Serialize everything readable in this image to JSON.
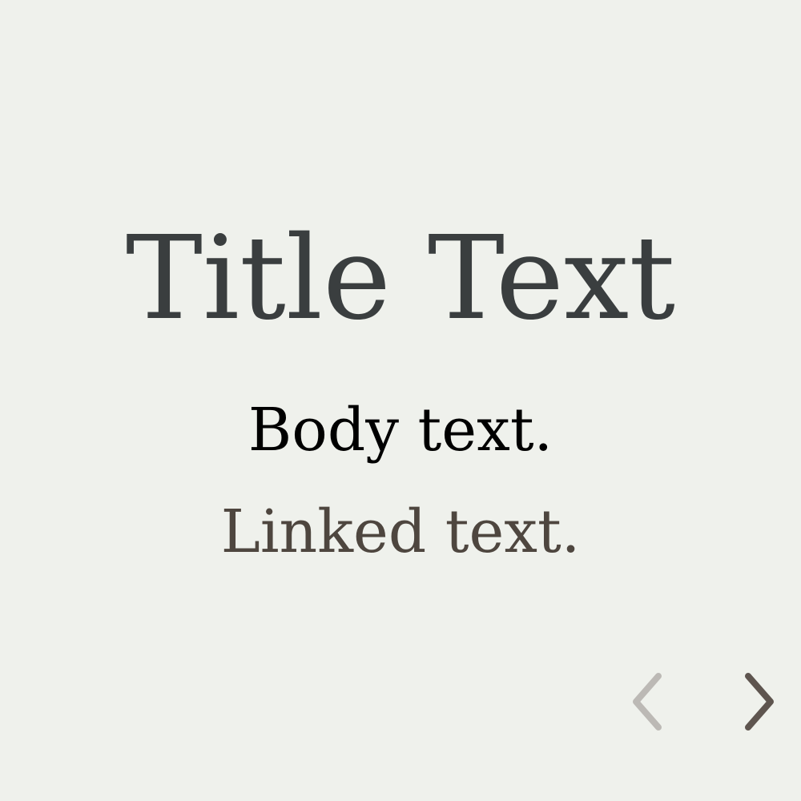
{
  "slide": {
    "title": "Title Text",
    "body": "Body text.",
    "link": "Linked text."
  },
  "navigation": {
    "prev_icon": "chevron-left-icon",
    "next_icon": "chevron-right-icon"
  },
  "colors": {
    "background": "#eff1ec",
    "title": "#3a3e3f",
    "body": "#000000",
    "link": "#4e463f",
    "prev_disabled": "#bcb9b5",
    "next_active": "#5e554f"
  }
}
